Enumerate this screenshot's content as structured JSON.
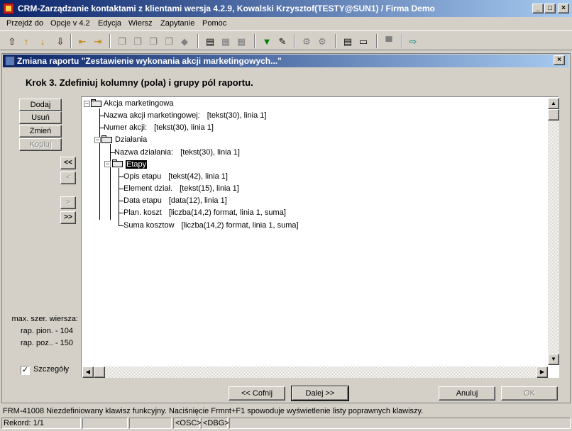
{
  "window": {
    "title": "CRM-Zarządzanie kontaktami z klientami wersja 4.2.9, Kowalski Krzysztof(TESTY@SUN1) / Firma Demo",
    "minimize_label": "_",
    "maximize_label": "□",
    "close_label": "×"
  },
  "menu": {
    "items": [
      "Przejdź do",
      "Opcje v 4.2",
      "Edycja",
      "Wiersz",
      "Zapytanie",
      "Pomoc"
    ]
  },
  "toolbar": {
    "icons": [
      "upload-icon",
      "arrow-up-icon",
      "arrow-down-icon",
      "download-icon",
      "first-record-icon",
      "last-record-icon",
      "new-record-icon",
      "copy-record-icon",
      "edit-record-icon",
      "delete-record-icon",
      "save-record-icon",
      "query-icon",
      "query-run-icon",
      "query-cancel-icon",
      "filter-icon",
      "clear-filter-icon",
      "tools-icon",
      "settings-icon",
      "document-icon",
      "preview-icon",
      "print-icon",
      "exit-icon"
    ]
  },
  "dialog": {
    "title": "Zmiana raportu \"Zestawienie wykonania akcji marketingowych...\"",
    "close_label": "×",
    "step_heading": "Krok 3. Zdefiniuj kolumny (pola) i grupy pól raportu.",
    "buttons": {
      "add": "Dodaj",
      "remove": "Usuń",
      "change": "Zmień",
      "copy": "Kopiuj"
    },
    "move_buttons": {
      "all_left": "<<",
      "left": "<",
      "right": ">",
      "all_right": ">>"
    },
    "info": {
      "max_width_label": "max. szer. wiersza:",
      "vertical": "rap. pion. - 104",
      "horizontal": "rap. poz.. - 150"
    },
    "details_checkbox": {
      "label": "Szczegóły",
      "checked": true,
      "mark": "✓"
    },
    "tree": {
      "root": "Akcja marketingowa",
      "root_fields": [
        {
          "name": "Nazwa akcji marketingowej:",
          "type": "[tekst(30), linia 1]"
        },
        {
          "name": "Numer akcji:",
          "type": "[tekst(30), linia 1]"
        }
      ],
      "group1": "Działania",
      "group1_fields": [
        {
          "name": "Nazwa działania:",
          "type": "[tekst(30), linia 1]"
        }
      ],
      "group2": "Etapy",
      "group2_fields": [
        {
          "name": "Opis etapu",
          "type": "[tekst(42), linia 1]"
        },
        {
          "name": "Element dział.",
          "type": "[tekst(15), linia 1]"
        },
        {
          "name": "Data etapu",
          "type": "[data(12), linia 1]"
        },
        {
          "name": "Plan. koszt",
          "type": "[liczba(14,2) format, linia 1, suma]"
        },
        {
          "name": "Suma kosztow",
          "type": "[liczba(14,2) format, linia 1, suma]"
        }
      ],
      "collapse_mark": "−"
    },
    "nav": {
      "back": "<< Cofnij",
      "next": "Dalej >>",
      "cancel": "Anuluj",
      "ok": "OK"
    }
  },
  "status": {
    "message": "FRM-41008 Niezdefiniowany klawisz funkcyjny. Naciśnięcie Frmnt+F1  spowoduje wyświetlenie listy poprawnych klawiszy.",
    "record": "Rekord: 1/1",
    "osc": "<OSC>",
    "dbg": "<DBG>"
  },
  "colors": {
    "titlebar_start": "#0a246a",
    "titlebar_end": "#a6caf0",
    "face": "#d4d0c8"
  }
}
